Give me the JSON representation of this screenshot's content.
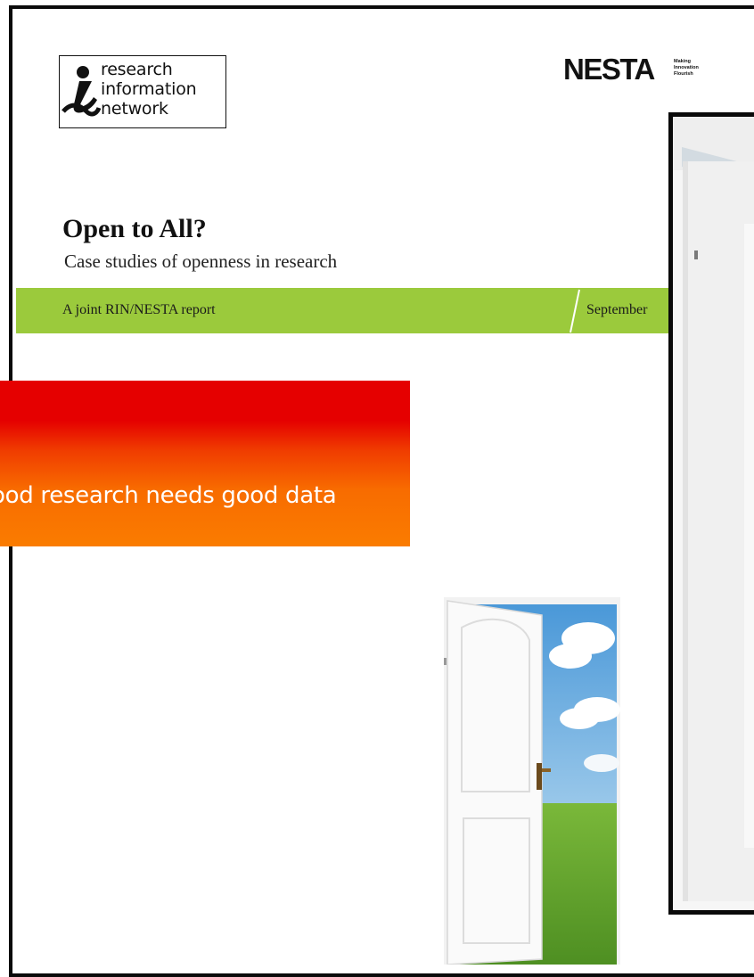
{
  "rin_logo": {
    "lines": [
      "research",
      "information",
      "network"
    ]
  },
  "nesta_logo": {
    "word": "NESTA",
    "tagline": [
      "Making",
      "Innovation",
      "Flourish"
    ]
  },
  "cover": {
    "title": "Open to All?",
    "subtitle": "Case studies of openness in research",
    "band_left": "A joint RIN/NESTA report",
    "band_right": "September"
  },
  "banner": {
    "text": "ood research needs good data"
  },
  "colors": {
    "band_green": "#9bca3c",
    "banner_red": "#e50000",
    "banner_orange": "#fa7c00",
    "frame_black": "#0a0a0a"
  }
}
